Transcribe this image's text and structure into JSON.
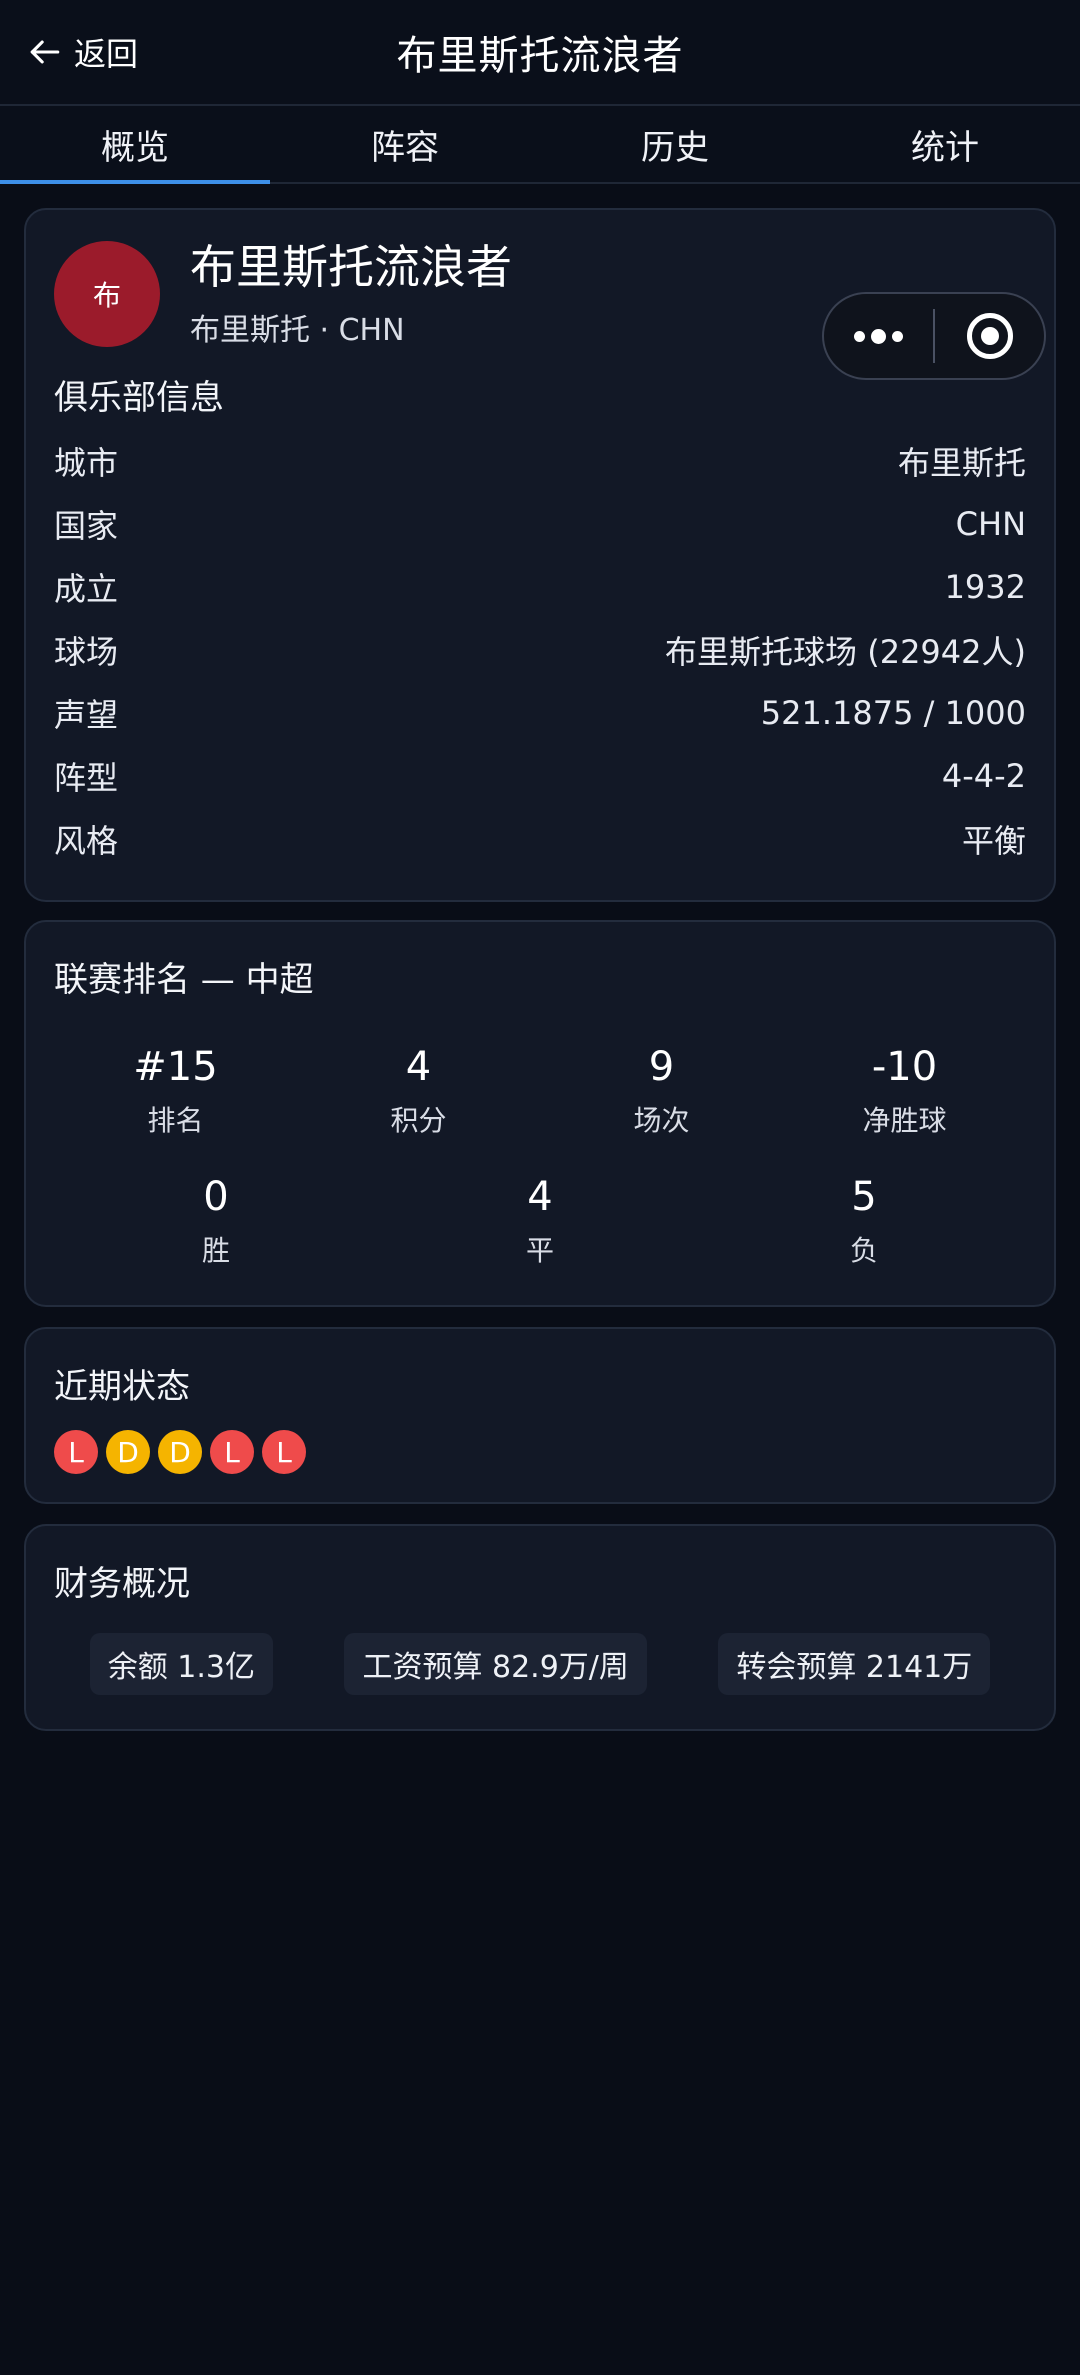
{
  "header": {
    "back_label": "返回",
    "title": "布里斯托流浪者"
  },
  "tabs": [
    {
      "label": "概览",
      "active": true
    },
    {
      "label": "阵容",
      "active": false
    },
    {
      "label": "历史",
      "active": false
    },
    {
      "label": "统计",
      "active": false
    }
  ],
  "club": {
    "logo_text": "布",
    "logo_color": "#9b1b2b",
    "name": "布里斯托流浪者",
    "subtitle": "布里斯托 · CHN"
  },
  "info": {
    "title": "俱乐部信息",
    "rows": [
      {
        "key": "城市",
        "value": "布里斯托"
      },
      {
        "key": "国家",
        "value": "CHN"
      },
      {
        "key": "成立",
        "value": "1932"
      },
      {
        "key": "球场",
        "value": "布里斯托球场 (22942人)"
      },
      {
        "key": "声望",
        "value": "521.1875 / 1000"
      },
      {
        "key": "阵型",
        "value": "4-4-2"
      },
      {
        "key": "风格",
        "value": "平衡"
      }
    ]
  },
  "league": {
    "title": "联赛排名 — 中超",
    "top": [
      {
        "num": "#15",
        "label": "排名"
      },
      {
        "num": "4",
        "label": "积分"
      },
      {
        "num": "9",
        "label": "场次"
      },
      {
        "num": "-10",
        "label": "净胜球"
      }
    ],
    "bottom": [
      {
        "num": "0",
        "label": "胜"
      },
      {
        "num": "4",
        "label": "平"
      },
      {
        "num": "5",
        "label": "负"
      }
    ]
  },
  "form": {
    "title": "近期状态",
    "results": [
      "L",
      "D",
      "D",
      "L",
      "L"
    ],
    "colors": {
      "L": "#ef4b4b",
      "D": "#f5b400"
    }
  },
  "finance": {
    "title": "财务概况",
    "chips": [
      "余额 1.3亿",
      "工资预算 82.9万/周",
      "转会预算 2141万"
    ]
  }
}
